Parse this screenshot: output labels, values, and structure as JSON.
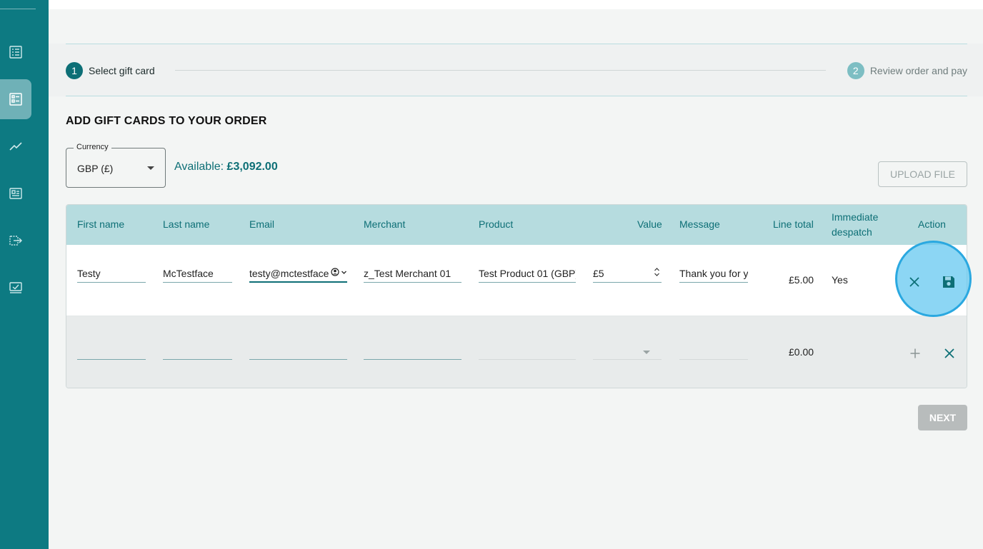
{
  "sidebar": {
    "items": [
      {
        "icon": "list-icon"
      },
      {
        "icon": "order-form-icon",
        "active": true
      },
      {
        "icon": "trend-chart-icon"
      },
      {
        "icon": "report-icon"
      },
      {
        "icon": "transfer-icon"
      },
      {
        "icon": "checked-screen-icon"
      }
    ]
  },
  "stepper": {
    "steps": [
      {
        "number": "1",
        "label": "Select gift card"
      },
      {
        "number": "2",
        "label": "Review order and pay"
      }
    ]
  },
  "page": {
    "heading": "ADD GIFT CARDS TO YOUR ORDER",
    "currency_label": "Currency",
    "currency_value": "GBP (£)",
    "available_prefix": "Available:",
    "available_amount": "£3,092.00",
    "upload_label": "UPLOAD FILE",
    "next_label": "NEXT"
  },
  "table": {
    "headers": {
      "first_name": "First name",
      "last_name": "Last name",
      "email": "Email",
      "merchant": "Merchant",
      "product": "Product",
      "value": "Value",
      "message": "Message",
      "line_total": "Line total",
      "immediate_line1": "Immediate",
      "immediate_line2": "despatch",
      "action": "Action"
    },
    "rows": [
      {
        "first_name": "Testy",
        "last_name": "McTestface",
        "email": "testy@mctestface",
        "merchant": "z_Test Merchant 01",
        "product": "Test Product 01 (GBP)",
        "value": "£5",
        "message": "Thank you for y",
        "line_total": "£5.00",
        "immediate": "Yes"
      },
      {
        "first_name": "",
        "last_name": "",
        "email": "",
        "merchant": "",
        "product": "",
        "value": "",
        "message": "",
        "line_total": "£0.00",
        "immediate": ""
      }
    ]
  },
  "colors": {
    "sidebar": "#0d7a82",
    "accent": "#0d6f76",
    "table_header": "#b6dcdf",
    "highlight": "#2aa8e0"
  }
}
